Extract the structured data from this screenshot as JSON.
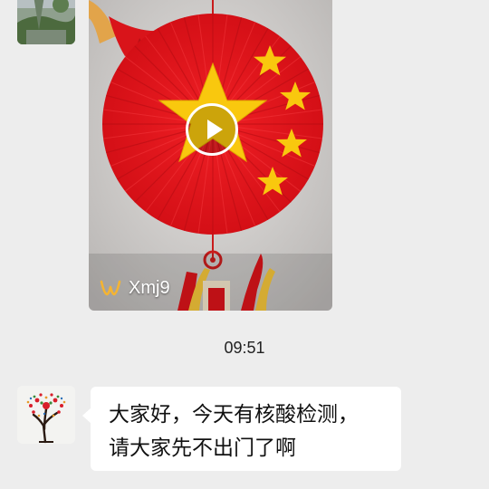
{
  "messages": {
    "video": {
      "channel": "Xmj9",
      "icon": "channels-logo-icon",
      "play_icon": "play-icon"
    },
    "timestamp": "09:51",
    "text_message": {
      "line1": "大家好，今天有核酸检测，",
      "line2": "请大家先不出门了啊"
    }
  },
  "colors": {
    "background": "#ededed",
    "bubble": "#ffffff",
    "fan_red": "#e8161c",
    "star_gold": "#f7c600",
    "text": "#111111"
  }
}
